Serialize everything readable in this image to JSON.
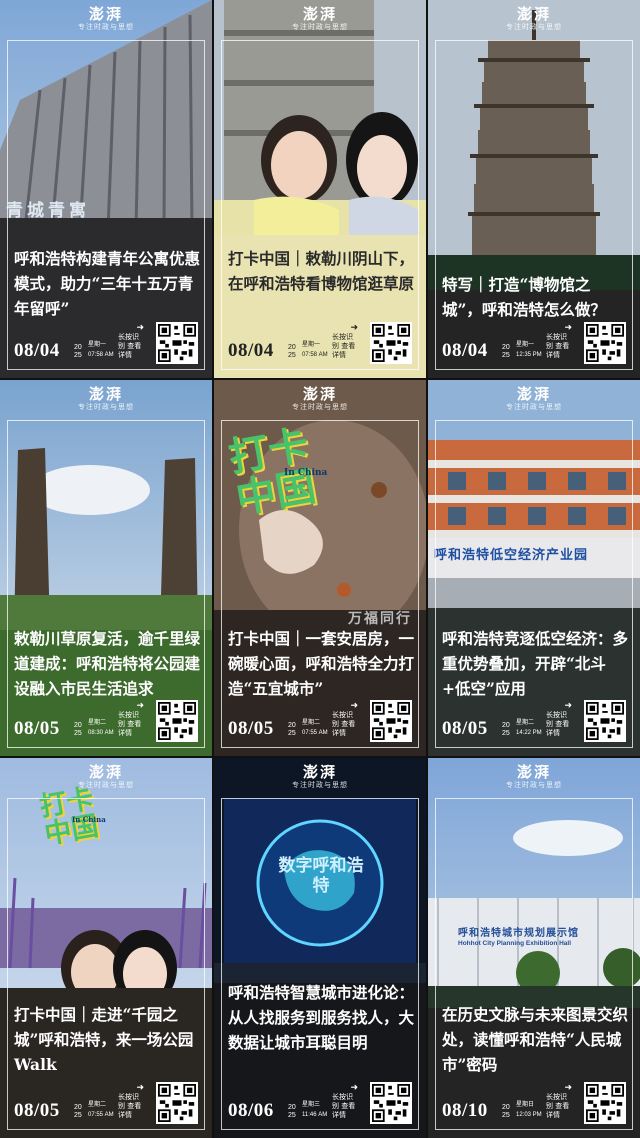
{
  "brand": {
    "name": "澎湃",
    "slogan": "专注时政与思想"
  },
  "common": {
    "long_press": "长按识别 查看详情",
    "arrow": "➜"
  },
  "cards": [
    {
      "headline": "呼和浩特构建青年公寓优惠模式，助力“三年十五万青年留呼”",
      "date": "08/04",
      "year": "20 25",
      "weekday": "星期一",
      "time": "07:58 AM",
      "sign": "青城青寓"
    },
    {
      "headline": "打卡中国｜敕勒川阴山下，在呼和浩特看博物馆逛草原",
      "date": "08/04",
      "year": "20 25",
      "weekday": "星期一",
      "time": "07:58 AM"
    },
    {
      "headline": "特写｜打造“博物馆之城”，呼和浩特怎么做？",
      "date": "08/04",
      "year": "20 25",
      "weekday": "星期一",
      "time": "12:35 PM"
    },
    {
      "headline": "敕勒川草原复活，逾千里绿道建成：呼和浩特将公园建设融入市民生活追求",
      "date": "08/05",
      "year": "20 25",
      "weekday": "星期二",
      "time": "08:30 AM"
    },
    {
      "headline": "打卡中国｜一套安居房，一碗暖心面，呼和浩特全力打造“五宜城市”",
      "date": "08/05",
      "year": "20 25",
      "weekday": "星期二",
      "time": "07:55 AM",
      "stamp_main": "打卡中国",
      "stamp_sub": "In China",
      "sign": "万福同行"
    },
    {
      "headline": "呼和浩特竞逐低空经济：多重优势叠加，开辟“北斗+低空”应用",
      "date": "08/05",
      "year": "20 25",
      "weekday": "星期二",
      "time": "14:22 PM",
      "sign": "呼和浩特低空经济产业园"
    },
    {
      "headline": "打卡中国｜走进“千园之城”呼和浩特，来一场公园Walk",
      "date": "08/05",
      "year": "20 25",
      "weekday": "星期二",
      "time": "07:55 AM",
      "stamp_main": "打卡中国",
      "stamp_sub": "In China"
    },
    {
      "headline": "呼和浩特智慧城市进化论：从人找服务到服务找人，大数据让城市耳聪目明",
      "date": "08/06",
      "year": "20 25",
      "weekday": "星期三",
      "time": "11:46 AM",
      "screen": "数字呼和浩特"
    },
    {
      "headline": "在历史文脉与未来图景交织处，读懂呼和浩特“人民城市”密码",
      "date": "08/10",
      "year": "20 25",
      "weekday": "星期日",
      "time": "12:03 PM",
      "sign": "呼和浩特城市规划展示馆",
      "sign_en": "Hohhot City Planning Exhibition Hall"
    }
  ]
}
